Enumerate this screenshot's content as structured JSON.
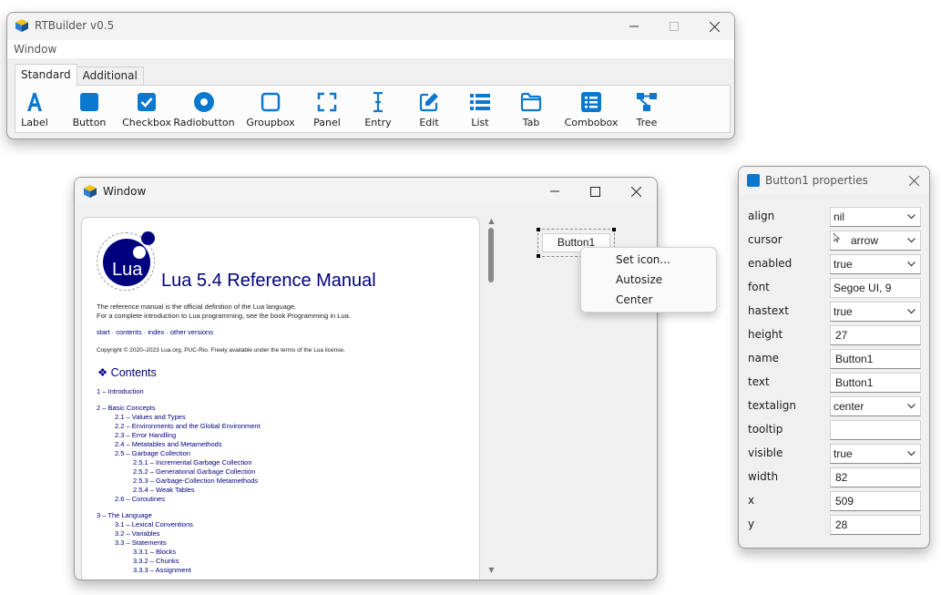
{
  "builder": {
    "title": "RTBuilder v0.5",
    "menu": [
      "Window"
    ],
    "tabs": [
      "Standard",
      "Additional"
    ],
    "tools": [
      {
        "label": "Label",
        "icon": "label-icon"
      },
      {
        "label": "Button",
        "icon": "button-icon"
      },
      {
        "label": "Checkbox",
        "icon": "checkbox-icon"
      },
      {
        "label": "Radiobutton",
        "icon": "radiobutton-icon"
      },
      {
        "label": "Groupbox",
        "icon": "groupbox-icon"
      },
      {
        "label": "Panel",
        "icon": "panel-icon"
      },
      {
        "label": "Entry",
        "icon": "entry-icon"
      },
      {
        "label": "Edit",
        "icon": "edit-icon"
      },
      {
        "label": "List",
        "icon": "list-icon"
      },
      {
        "label": "Tab",
        "icon": "tab-icon"
      },
      {
        "label": "Combobox",
        "icon": "combobox-icon"
      },
      {
        "label": "Tree",
        "icon": "tree-icon"
      }
    ]
  },
  "design": {
    "title": "Window",
    "doc": {
      "logo_text": "Lua",
      "title": "Lua 5.4 Reference Manual",
      "intro1": "The reference manual is the official definition of the Lua language.",
      "intro2": "For a complete introduction to Lua programming, see the book Programming in Lua.",
      "links": "start · contents · index · other versions",
      "copyright": "Copyright © 2020–2023 Lua.org, PUC-Rio. Freely available under the terms of the Lua license.",
      "contents_heading": "❖  Contents",
      "toc": [
        {
          "level": 0,
          "text": "1 – Introduction"
        },
        {
          "level": 0,
          "text": "2 – Basic Concepts"
        },
        {
          "level": 1,
          "text": "2.1 – Values and Types"
        },
        {
          "level": 1,
          "text": "2.2 – Environments and the Global Environment"
        },
        {
          "level": 1,
          "text": "2.3 – Error Handling"
        },
        {
          "level": 1,
          "text": "2.4 – Metatables and Metamethods"
        },
        {
          "level": 1,
          "text": "2.5 – Garbage Collection"
        },
        {
          "level": 2,
          "text": "2.5.1 – Incremental Garbage Collection"
        },
        {
          "level": 2,
          "text": "2.5.2 – Generational Garbage Collection"
        },
        {
          "level": 2,
          "text": "2.5.3 – Garbage-Collection Metamethods"
        },
        {
          "level": 2,
          "text": "2.5.4 – Weak Tables"
        },
        {
          "level": 1,
          "text": "2.6 – Coroutines"
        },
        {
          "level": 0,
          "text": "3 – The Language"
        },
        {
          "level": 1,
          "text": "3.1 – Lexical Conventions"
        },
        {
          "level": 1,
          "text": "3.2 – Variables"
        },
        {
          "level": 1,
          "text": "3.3 – Statements"
        },
        {
          "level": 2,
          "text": "3.3.1 – Blocks"
        },
        {
          "level": 2,
          "text": "3.3.2 – Chunks"
        },
        {
          "level": 2,
          "text": "3.3.3 – Assignment"
        }
      ]
    },
    "button_label": "Button1",
    "context_menu": [
      "Set icon...",
      "Autosize",
      "Center"
    ]
  },
  "props": {
    "title": "Button1 properties",
    "rows": [
      {
        "name": "align",
        "value": "nil",
        "type": "combo"
      },
      {
        "name": "cursor",
        "value": "arrow",
        "type": "combo"
      },
      {
        "name": "enabled",
        "value": "true",
        "type": "combo"
      },
      {
        "name": "font",
        "value": "Segoe UI, 9",
        "type": "field"
      },
      {
        "name": "hastext",
        "value": "true",
        "type": "combo"
      },
      {
        "name": "height",
        "value": "27",
        "type": "edit"
      },
      {
        "name": "name",
        "value": "Button1",
        "type": "edit"
      },
      {
        "name": "text",
        "value": "Button1",
        "type": "edit"
      },
      {
        "name": "textalign",
        "value": "center",
        "type": "combo"
      },
      {
        "name": "tooltip",
        "value": "",
        "type": "edit"
      },
      {
        "name": "visible",
        "value": "true",
        "type": "combo"
      },
      {
        "name": "width",
        "value": "82",
        "type": "edit"
      },
      {
        "name": "x",
        "value": "509",
        "type": "edit"
      },
      {
        "name": "y",
        "value": "28",
        "type": "edit"
      }
    ]
  },
  "colors": {
    "accent": "#0b78d0",
    "lua_blue": "#00007f"
  }
}
